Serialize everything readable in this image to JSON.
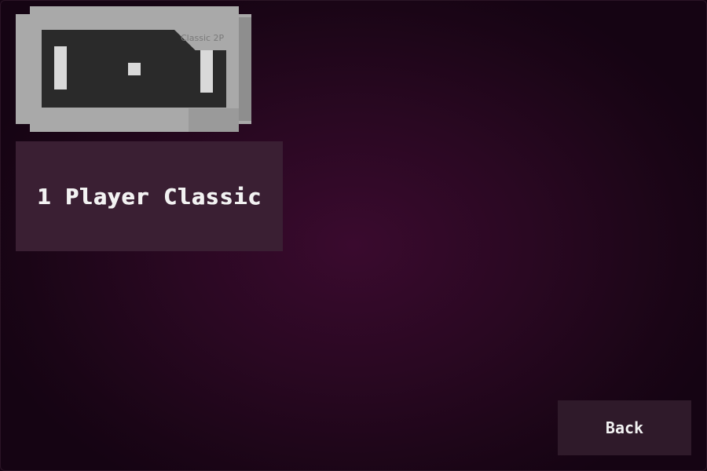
{
  "cartridge": {
    "label": "Classic 2P",
    "icon": "pong-cartridge-icon"
  },
  "mode_button": {
    "label": "1 Player Classic"
  },
  "back_button": {
    "label": "Back"
  },
  "colors": {
    "background": "#2a0822",
    "button_bg": "#3a1f33",
    "back_bg": "#2f1a2a",
    "cartridge_body": "#a9a9a9",
    "cartridge_screen": "#2a2a2a",
    "text": "#f2f2f2"
  }
}
